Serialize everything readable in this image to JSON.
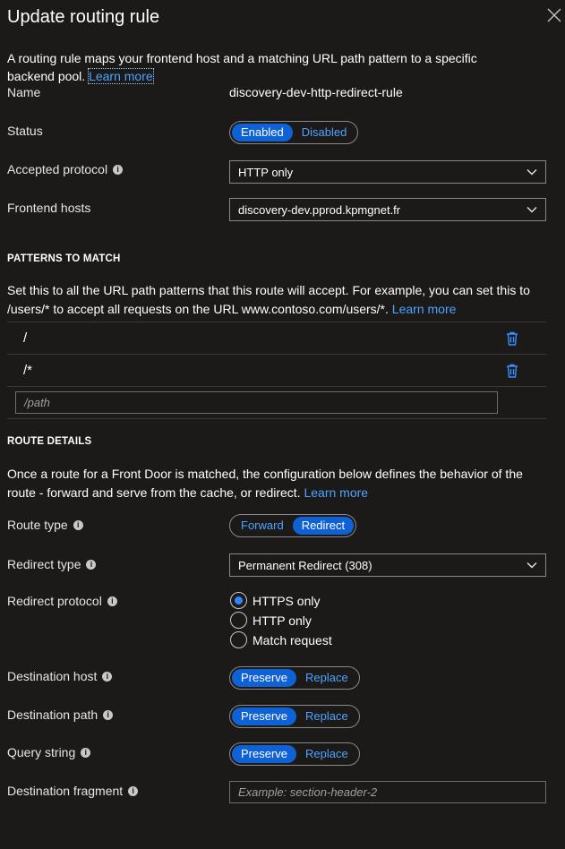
{
  "panel": {
    "title": "Update routing rule",
    "intro_text": "A routing rule maps your frontend host and a matching URL path pattern to a specific backend pool.",
    "intro_link": "Learn more"
  },
  "fields": {
    "name_label": "Name",
    "name_value": "discovery-dev-http-redirect-rule",
    "status_label": "Status",
    "status_on": "Enabled",
    "status_off": "Disabled",
    "protocol_label": "Accepted protocol",
    "protocol_value": "HTTP only",
    "hosts_label": "Frontend hosts",
    "hosts_value": "discovery-dev.pprod.kpmgnet.fr"
  },
  "patterns": {
    "heading": "PATTERNS TO MATCH",
    "description": "Set this to all the URL path patterns that this route will accept. For example, you can set this to /users/* to accept all requests on the URL www.contoso.com/users/*.",
    "link": "Learn more",
    "items": [
      "/",
      "/*"
    ],
    "input_placeholder": "/path"
  },
  "route": {
    "heading": "ROUTE DETAILS",
    "description": "Once a route for a Front Door is matched, the configuration below defines the behavior of the route - forward and serve from the cache, or redirect.",
    "link": "Learn more",
    "route_type_label": "Route type",
    "route_type_forward": "Forward",
    "route_type_redirect": "Redirect",
    "redirect_type_label": "Redirect type",
    "redirect_type_value": "Permanent Redirect (308)",
    "redirect_protocol_label": "Redirect protocol",
    "redirect_protocol_options": [
      "HTTPS only",
      "HTTP only",
      "Match request"
    ],
    "dest_host_label": "Destination host",
    "dest_path_label": "Destination path",
    "query_label": "Query string",
    "preserve": "Preserve",
    "replace": "Replace",
    "fragment_label": "Destination fragment",
    "fragment_placeholder": "Example: section-header-2"
  },
  "colors": {
    "accent": "#0f62d6",
    "link": "#4da3ff",
    "background": "#1b1a19"
  }
}
